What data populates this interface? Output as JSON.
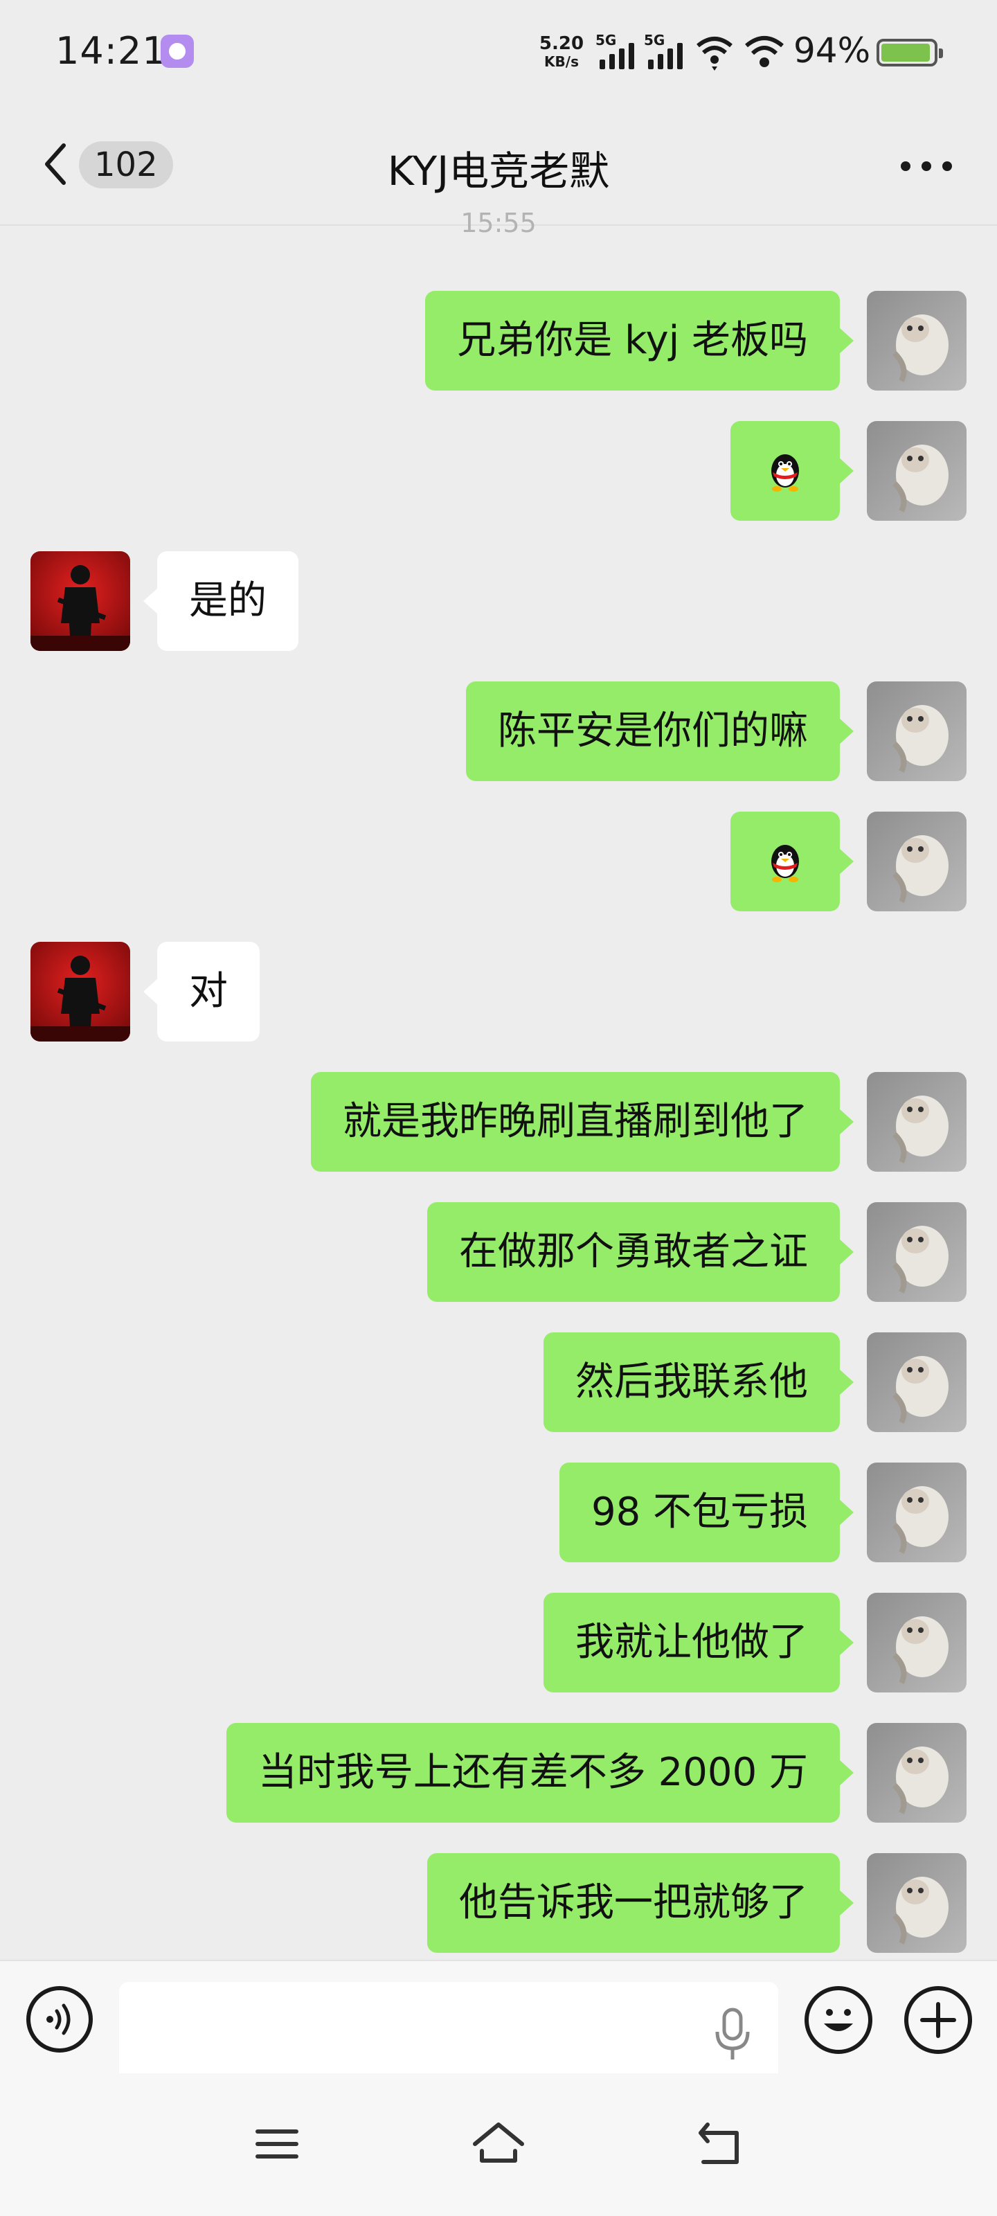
{
  "status_bar": {
    "time": "14:21",
    "net_speed_value": "5.20",
    "net_speed_unit": "KB/s",
    "sim1_label": "5G",
    "sim2_label": "5G",
    "battery_percent": "94%",
    "battery_level": 0.94
  },
  "header": {
    "unread_count": "102",
    "title": "KYJ电竞老默"
  },
  "time_separator": "15:55",
  "messages": [
    {
      "side": "me",
      "type": "text",
      "text": "兄弟你是 kyj 老板吗"
    },
    {
      "side": "me",
      "type": "emoji",
      "emoji": "penguin-sticker"
    },
    {
      "side": "them",
      "type": "text",
      "text": "是的"
    },
    {
      "side": "me",
      "type": "text",
      "text": "陈平安是你们的嘛"
    },
    {
      "side": "me",
      "type": "emoji",
      "emoji": "penguin-sticker"
    },
    {
      "side": "them",
      "type": "text",
      "text": "对"
    },
    {
      "side": "me",
      "type": "text",
      "text": "就是我昨晚刷直播刷到他了"
    },
    {
      "side": "me",
      "type": "text",
      "text": "在做那个勇敢者之证"
    },
    {
      "side": "me",
      "type": "text",
      "text": "然后我联系他"
    },
    {
      "side": "me",
      "type": "text",
      "text": "98 不包亏损"
    },
    {
      "side": "me",
      "type": "text",
      "text": "我就让他做了"
    },
    {
      "side": "me",
      "type": "text",
      "text": "当时我号上还有差不多 2000 万"
    },
    {
      "side": "me",
      "type": "text",
      "text": "他告诉我一把就够了"
    }
  ],
  "input_bar": {
    "text_value": "",
    "voice_icon": "voice-wave-icon",
    "mic_icon": "microphone-icon",
    "emoji_icon": "smiley-icon",
    "plus_icon": "plus-icon"
  },
  "colors": {
    "my_bubble": "#95ec69",
    "their_bubble": "#ffffff",
    "background": "#ededed",
    "battery": "#7cc24d"
  }
}
